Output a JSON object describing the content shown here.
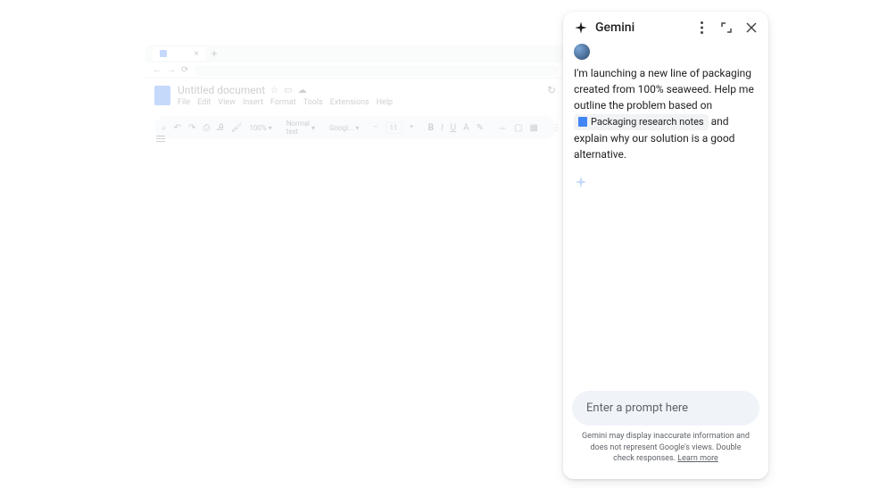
{
  "docs": {
    "title": "Untitled document",
    "menu": [
      "File",
      "Edit",
      "View",
      "Insert",
      "Format",
      "Tools",
      "Extensions",
      "Help"
    ],
    "toolbar": {
      "zoom": "100%",
      "style": "Normal text",
      "font": "Googl...",
      "size": "11"
    }
  },
  "gemini": {
    "title": "Gemini",
    "message": {
      "part1": "I'm launching a new line of packaging created from 100% seaweed. Help me outline the problem based on ",
      "chip": "Packaging research notes",
      "part2": " and explain why our solution is a good alternative."
    },
    "input_placeholder": "Enter a prompt here",
    "disclaimer": "Gemini may display inaccurate information and does not represent Google's views. Double check responses.",
    "learn_more": "Learn more"
  }
}
